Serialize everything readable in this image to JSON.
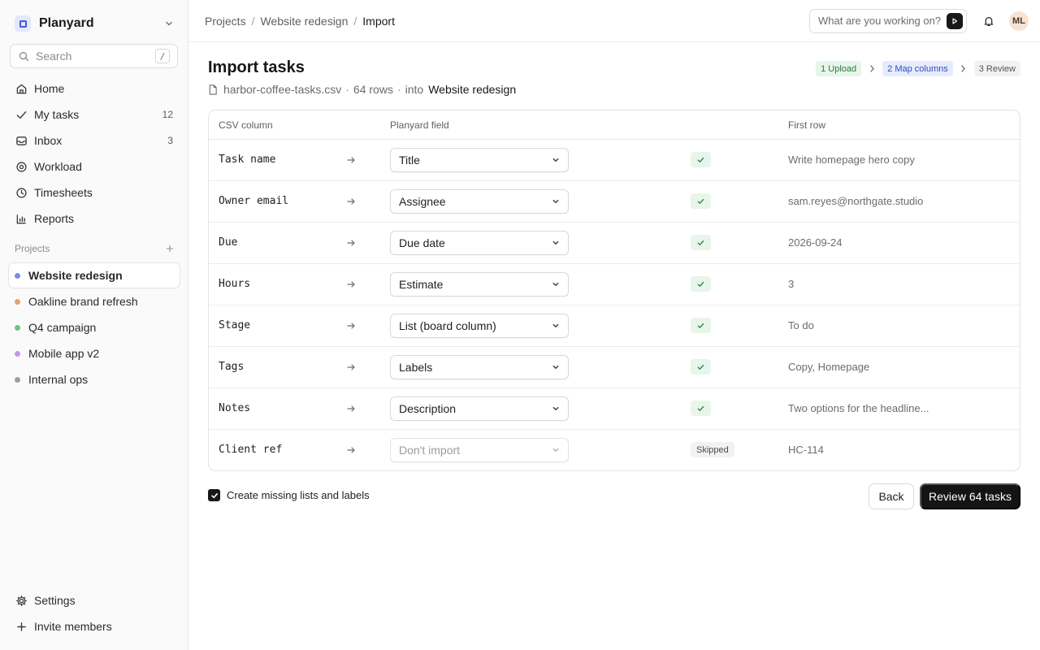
{
  "workspace": {
    "name": "Planyard"
  },
  "search": {
    "placeholder": "Search",
    "shortcut": "/"
  },
  "nav": {
    "items": [
      {
        "label": "Home",
        "icon": "home-icon",
        "count": ""
      },
      {
        "label": "My tasks",
        "icon": "check-icon",
        "count": "12"
      },
      {
        "label": "Inbox",
        "icon": "inbox-icon",
        "count": "3"
      },
      {
        "label": "Workload",
        "icon": "workload-icon",
        "count": ""
      },
      {
        "label": "Timesheets",
        "icon": "clock-icon",
        "count": ""
      },
      {
        "label": "Reports",
        "icon": "bar-chart-icon",
        "count": ""
      }
    ]
  },
  "projects": {
    "heading": "Projects",
    "items": [
      {
        "label": "Website redesign",
        "color": "#7b8cea",
        "active": true
      },
      {
        "label": "Oakline brand refresh",
        "color": "#eba063"
      },
      {
        "label": "Q4 campaign",
        "color": "#6cc385"
      },
      {
        "label": "Mobile app v2",
        "color": "#c497e4"
      },
      {
        "label": "Internal ops",
        "color": "#9d9da4"
      }
    ]
  },
  "bottom_nav": {
    "settings": "Settings",
    "invite": "Invite members"
  },
  "breadcrumb": {
    "items": [
      "Projects",
      "Website redesign",
      "Import"
    ]
  },
  "topbar": {
    "ask_placeholder": "What are you working on?",
    "avatar_initials": "ML"
  },
  "page": {
    "title": "Import tasks",
    "file_name": "harbor-coffee-tasks.csv",
    "rows_text": "64 rows",
    "into_text": "into",
    "target_project": "Website redesign"
  },
  "steps": [
    {
      "label": "1 Upload",
      "state": "done"
    },
    {
      "label": "2 Map columns",
      "state": "active"
    },
    {
      "label": "3 Review",
      "state": "todo"
    }
  ],
  "table": {
    "headers": {
      "csv": "CSV column",
      "field": "Planyard field",
      "first": "First row"
    },
    "rows": [
      {
        "csv": "Task name",
        "field": "Title",
        "status": "mapped",
        "first": "Write homepage hero copy"
      },
      {
        "csv": "Owner email",
        "field": "Assignee",
        "status": "mapped",
        "first": "sam.reyes@northgate.studio"
      },
      {
        "csv": "Due",
        "field": "Due date",
        "status": "mapped",
        "first": "2026-09-24"
      },
      {
        "csv": "Hours",
        "field": "Estimate",
        "status": "mapped",
        "first": "3"
      },
      {
        "csv": "Stage",
        "field": "List (board column)",
        "status": "mapped",
        "first": "To do"
      },
      {
        "csv": "Tags",
        "field": "Labels",
        "status": "mapped",
        "first": "Copy, Homepage"
      },
      {
        "csv": "Notes",
        "field": "Description",
        "status": "mapped",
        "first": "Two options for the headline..."
      },
      {
        "csv": "Client ref",
        "field": "Don't import",
        "status": "Skipped",
        "first": "HC-114"
      }
    ]
  },
  "footer": {
    "checkbox_label": "Create missing lists and labels",
    "checkbox_checked": true,
    "back": "Back",
    "primary": "Review 64 tasks"
  },
  "colors": {
    "primary": "#141416",
    "success_bg": "#e7f5ea",
    "success": "#2c7a3f",
    "accent": "#2f4dbf"
  }
}
